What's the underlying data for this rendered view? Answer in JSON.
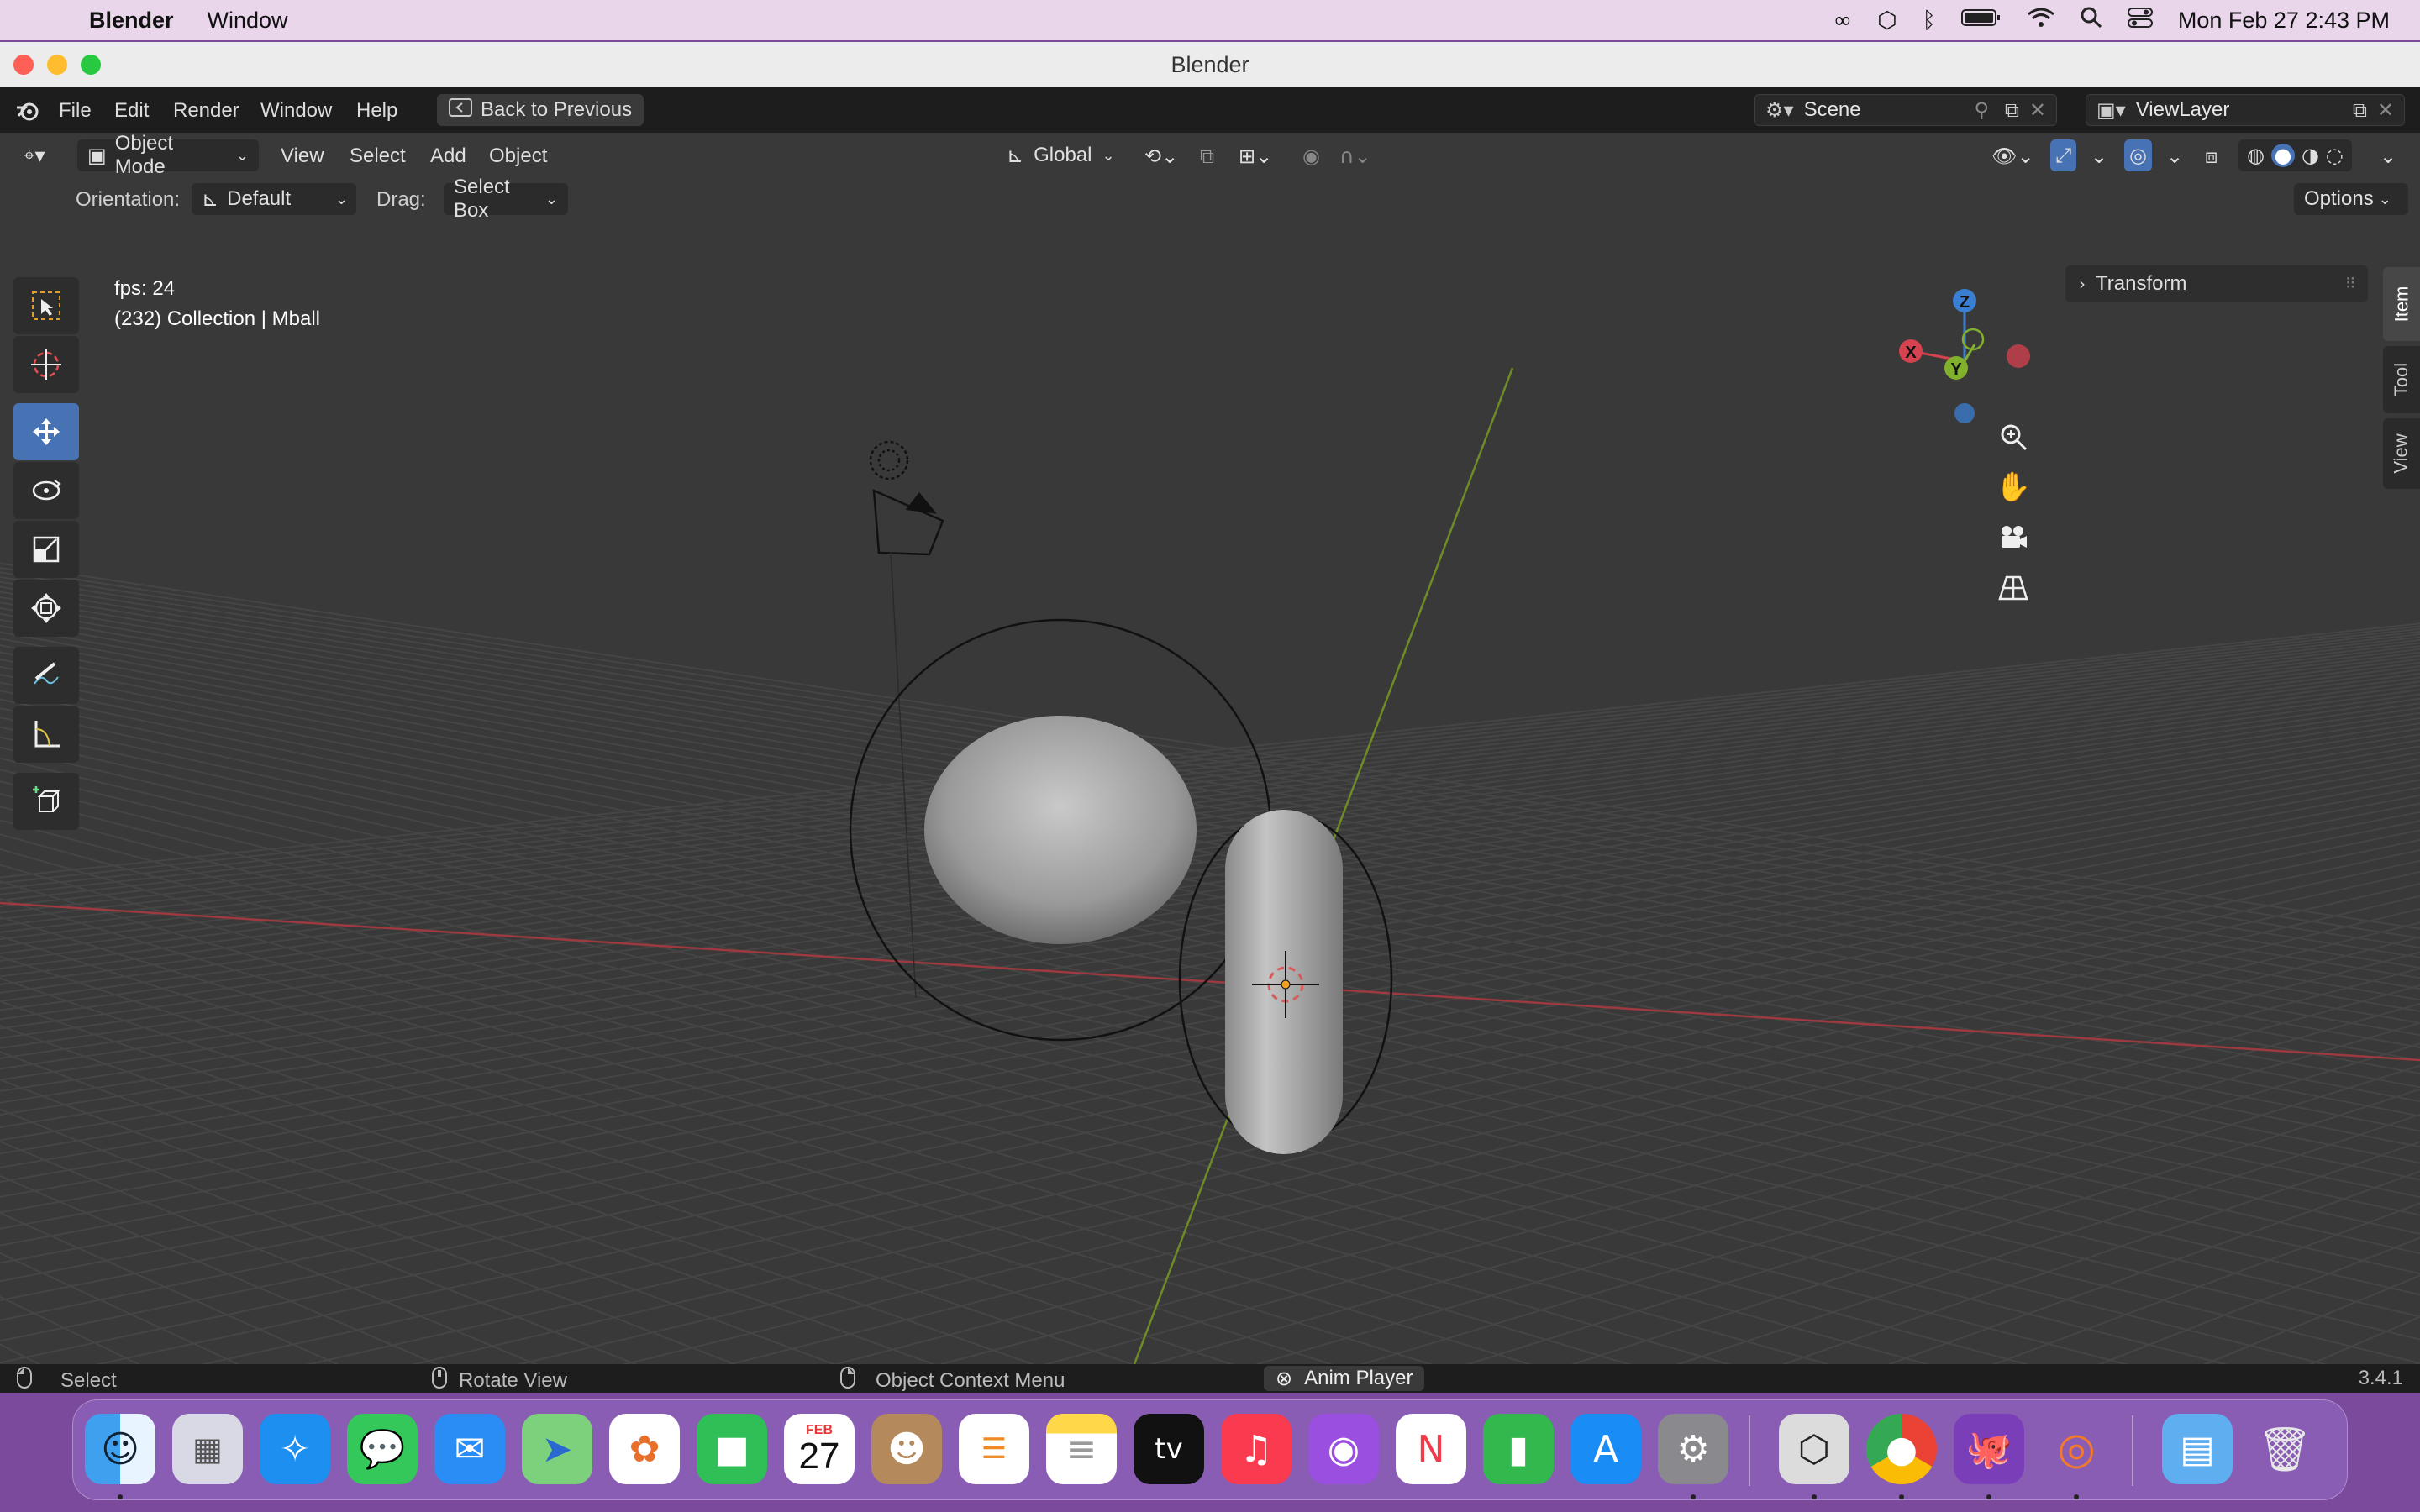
{
  "menubar": {
    "apple": "",
    "app_name": "Blender",
    "window_menu": "Window",
    "clock": "Mon Feb 27  2:43 PM"
  },
  "window": {
    "title": "Blender"
  },
  "topbar": {
    "menus": [
      "File",
      "Edit",
      "Render",
      "Window",
      "Help"
    ],
    "back_button": "Back to Previous",
    "scene_name": "Scene",
    "view_layer": "ViewLayer"
  },
  "viewport_header": {
    "mode": "Object Mode",
    "menus": [
      "View",
      "Select",
      "Add",
      "Object"
    ],
    "transform_orientation": "Global",
    "options_label": "Options"
  },
  "tool_settings": {
    "orientation_label": "Orientation:",
    "orientation_value": "Default",
    "drag_label": "Drag:",
    "drag_value": "Select Box"
  },
  "overlay": {
    "fps": "fps: 24",
    "collection": "(232) Collection | Mball"
  },
  "gizmo": {
    "x": "X",
    "y": "Y",
    "z": "Z"
  },
  "sidebar": {
    "panel_title": "Transform",
    "tabs": [
      "Item",
      "Tool",
      "View"
    ]
  },
  "statusbar": {
    "select": "Select",
    "rotate": "Rotate View",
    "context": "Object Context Menu",
    "anim_player": "Anim Player",
    "version": "3.4.1"
  },
  "dock": {
    "calendar_month": "FEB",
    "calendar_day": "27",
    "apps": [
      "Finder",
      "Launchpad",
      "Safari",
      "Messages",
      "Mail",
      "Maps",
      "Photos",
      "FaceTime",
      "Calendar",
      "Contacts",
      "Reminders",
      "Notes",
      "TV",
      "Music",
      "Podcasts",
      "News",
      "Numbers",
      "App Store",
      "System Settings",
      "Unity Hub",
      "Chrome",
      "GitHub Desktop",
      "Blender",
      "Downloads",
      "Trash"
    ]
  },
  "colors": {
    "viewport_bg": "#393939",
    "active_tool": "#4772b3",
    "x_axis": "#d6424f",
    "y_axis": "#80b02c",
    "z_axis": "#3b7fd3"
  }
}
